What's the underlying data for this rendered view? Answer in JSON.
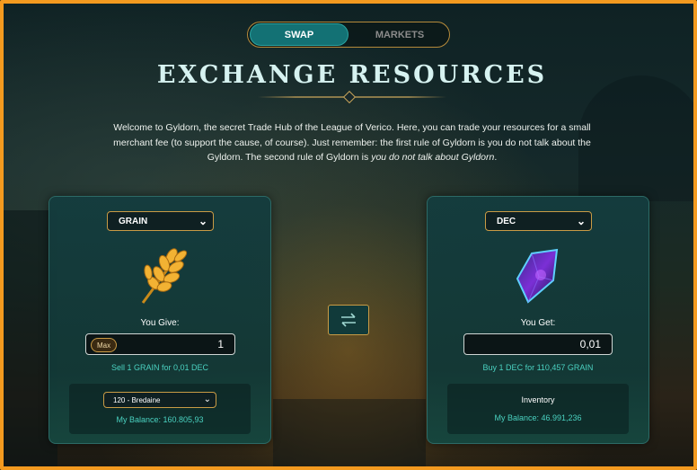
{
  "tabs": [
    {
      "label": "SWAP",
      "active": true
    },
    {
      "label": "MARKETS",
      "active": false
    }
  ],
  "title": "EXCHANGE RESOURCES",
  "intro": {
    "text": "Welcome to Gyldorn, the secret Trade Hub of the League of Verico. Here, you can trade your resources for a small merchant fee (to support the cause, of course). Just remember: the first rule of Gyldorn is you do not talk about the Gyldorn. The second rule of Gyldorn is ",
    "emphasis": "you do not talk about Gyldorn",
    "end": "."
  },
  "give": {
    "resource": "GRAIN",
    "icon": "grain-icon",
    "label": "You Give:",
    "max_label": "Max",
    "amount": "1",
    "rate": "Sell 1 GRAIN for 0,01 DEC",
    "land_select": "120 - Bredaine",
    "balance": "My Balance: 160.805,93"
  },
  "get": {
    "resource": "DEC",
    "icon": "dec-crystal-icon",
    "label": "You Get:",
    "amount": "0,01",
    "rate": "Buy 1 DEC for 110,457 GRAIN",
    "inventory_title": "Inventory",
    "balance": "My Balance: 46.991,236"
  },
  "swap_button_icon": "swap-arrows-icon",
  "colors": {
    "accent_teal": "#137174",
    "gold_border": "#c99b45",
    "frame_orange": "#f39a1f",
    "value_teal": "#4ad1c0"
  }
}
